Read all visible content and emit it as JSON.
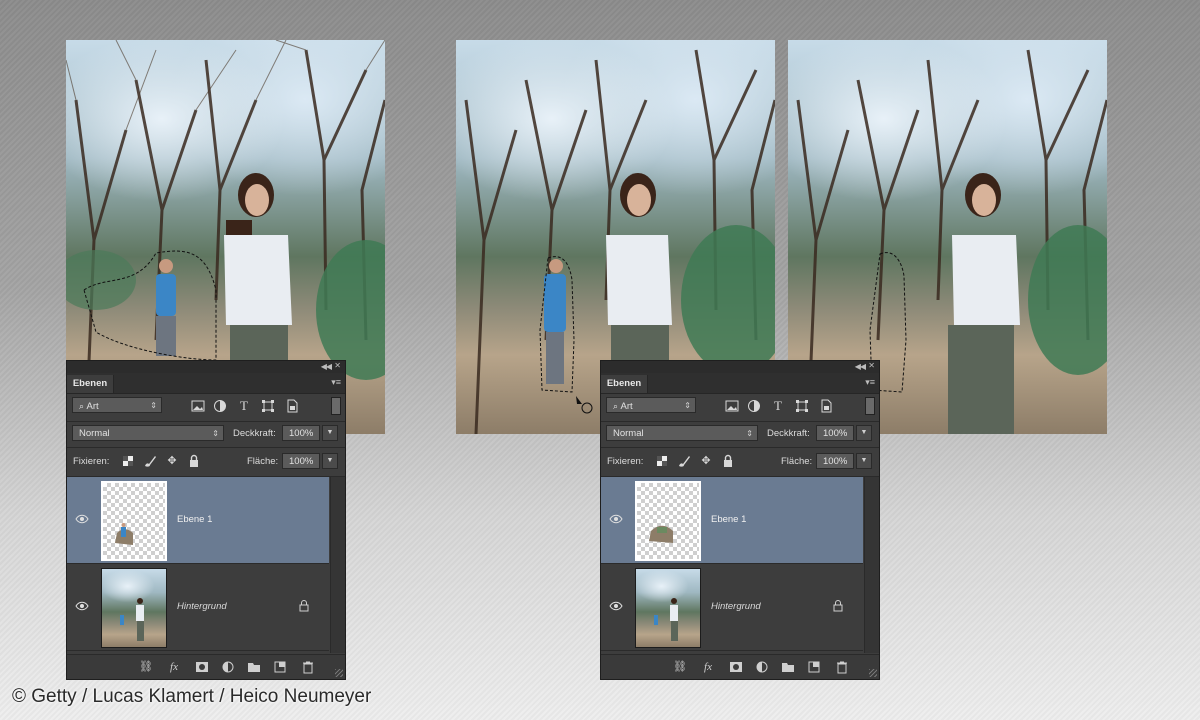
{
  "credit": "© Getty / Lucas Klamert / Heico Neumeyer",
  "panels": [
    {
      "tab": "Ebenen",
      "filter_kind": "Art",
      "blend_mode": "Normal",
      "opacity_label": "Deckkraft:",
      "opacity_value": "100%",
      "lock_label": "Fixieren:",
      "fill_label": "Fläche:",
      "fill_value": "100%",
      "layers": [
        {
          "name": "Ebene 1",
          "selected": true
        },
        {
          "name": "Hintergrund",
          "selected": false,
          "locked": true
        }
      ]
    },
    {
      "tab": "Ebenen",
      "filter_kind": "Art",
      "blend_mode": "Normal",
      "opacity_label": "Deckkraft:",
      "opacity_value": "100%",
      "lock_label": "Fixieren:",
      "fill_label": "Fläche:",
      "fill_value": "100%",
      "layers": [
        {
          "name": "Ebene 1",
          "selected": true
        },
        {
          "name": "Hintergrund",
          "selected": false,
          "locked": true
        }
      ]
    }
  ],
  "icons": {
    "visibility": "eye-icon",
    "filter_pixel": "image-icon",
    "filter_adjust": "adjustment-icon",
    "filter_type": "type-icon",
    "filter_shape": "shape-icon",
    "filter_smart": "smart-object-icon",
    "lock_transparent": "checkerboard-lock-icon",
    "lock_image": "brush-lock-icon",
    "lock_position": "move-lock-icon",
    "lock_all": "padlock-icon",
    "link": "link-icon",
    "fx": "fx-icon",
    "mask": "mask-icon",
    "adjustment_new": "half-circle-icon",
    "group": "folder-icon",
    "new_layer": "new-layer-icon",
    "delete": "trash-icon"
  },
  "colors": {
    "selected_layer": "#6a7b92",
    "panel_bg": "#3d3d3d"
  }
}
